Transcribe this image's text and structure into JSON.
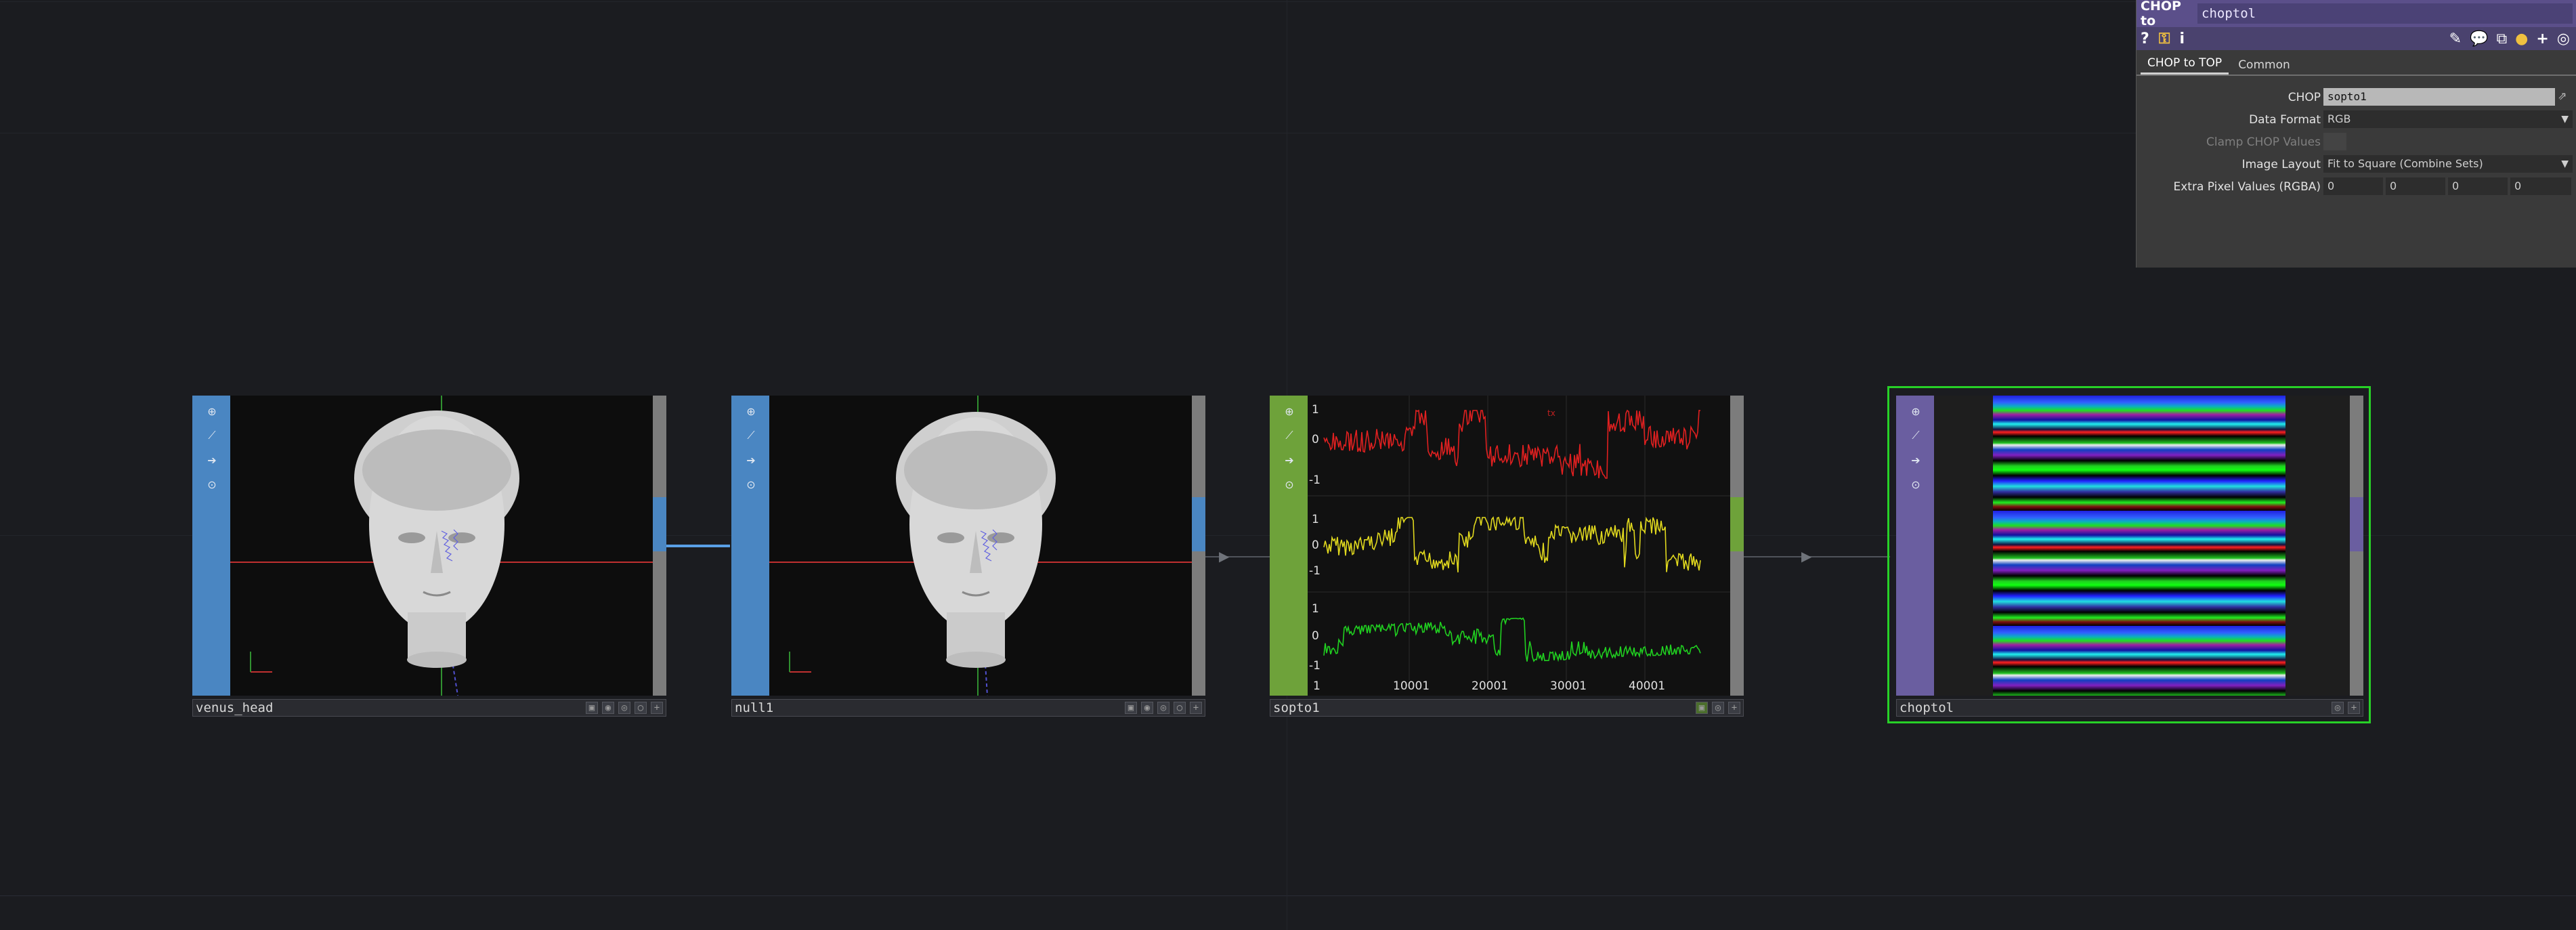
{
  "colors": {
    "top_node": "#4a86c2",
    "chop_node": "#6ea23a",
    "selected_outline": "#27d027",
    "red_channel": "#e02020",
    "yellow_channel": "#e0d81e",
    "green_channel": "#20d020"
  },
  "nodes": [
    {
      "name": "venus_head"
    },
    {
      "name": "null1"
    },
    {
      "name": "sopto1"
    },
    {
      "name": "choptol"
    }
  ],
  "sopto_plot": {
    "x_ticks": [
      "1",
      "10001",
      "20001",
      "30001",
      "40001"
    ],
    "y_ticks": [
      "1",
      "0",
      "-1"
    ],
    "top_marker": "tx"
  },
  "panel": {
    "type_label": "CHOP to",
    "node_name": "choptol",
    "tabs": [
      "CHOP to TOP",
      "Common"
    ],
    "params": [
      {
        "label": "CHOP",
        "value": "sopto1"
      },
      {
        "label": "Data Format",
        "value": "RGB"
      },
      {
        "label": "Clamp CHOP Values",
        "value": ""
      },
      {
        "label": "Image Layout",
        "value": "Fit to Square (Combine Sets)"
      },
      {
        "label": "Extra Pixel Values (RGBA)",
        "values": [
          "0",
          "0",
          "0",
          "0"
        ]
      }
    ],
    "icons": [
      "help-icon",
      "python-help-icon",
      "info-icon",
      "edit-icon",
      "comment-icon",
      "copy-icon",
      "python-icon",
      "add-icon",
      "target-icon"
    ]
  }
}
